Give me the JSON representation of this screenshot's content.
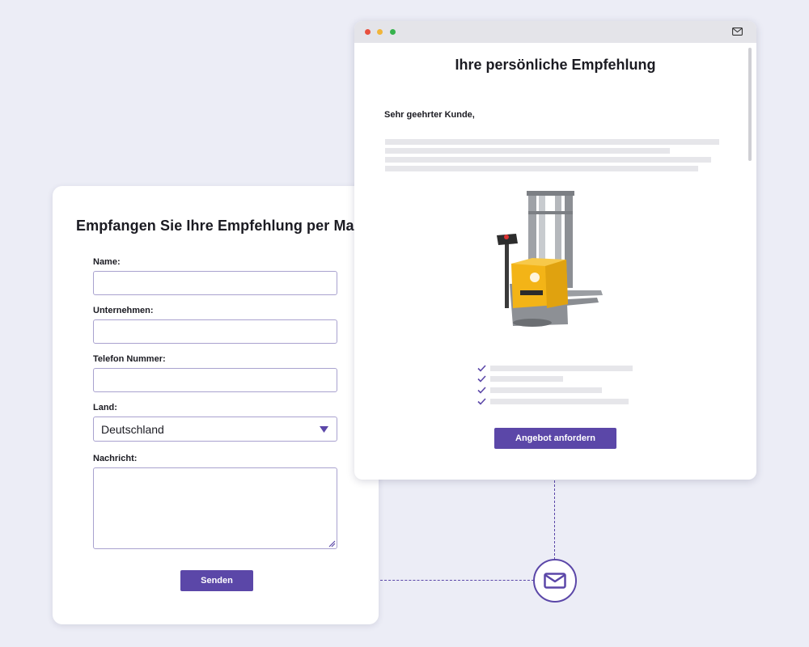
{
  "form": {
    "title": "Empfangen Sie Ihre Empfehlung per Mail",
    "fields": {
      "name_label": "Name:",
      "company_label": "Unternehmen:",
      "phone_label": "Telefon Nummer:",
      "country_label": "Land:",
      "country_value": "Deutschland",
      "message_label": "Nachricht:"
    },
    "submit_label": "Senden"
  },
  "email": {
    "title": "Ihre persönliche Empfehlung",
    "salutation": "Sehr geehrter Kunde,",
    "cta_label": "Angebot anfordern",
    "product_icon": "forklift-stacker-image"
  },
  "icons": {
    "connector": "mail-icon",
    "titlebar": "mail-icon",
    "checklist": "check-icon"
  },
  "colors": {
    "accent": "#5b47a8",
    "background": "#ecedf6",
    "window_close": "#e8503e",
    "window_minimize": "#f1b53a",
    "window_maximize": "#37b24d"
  }
}
